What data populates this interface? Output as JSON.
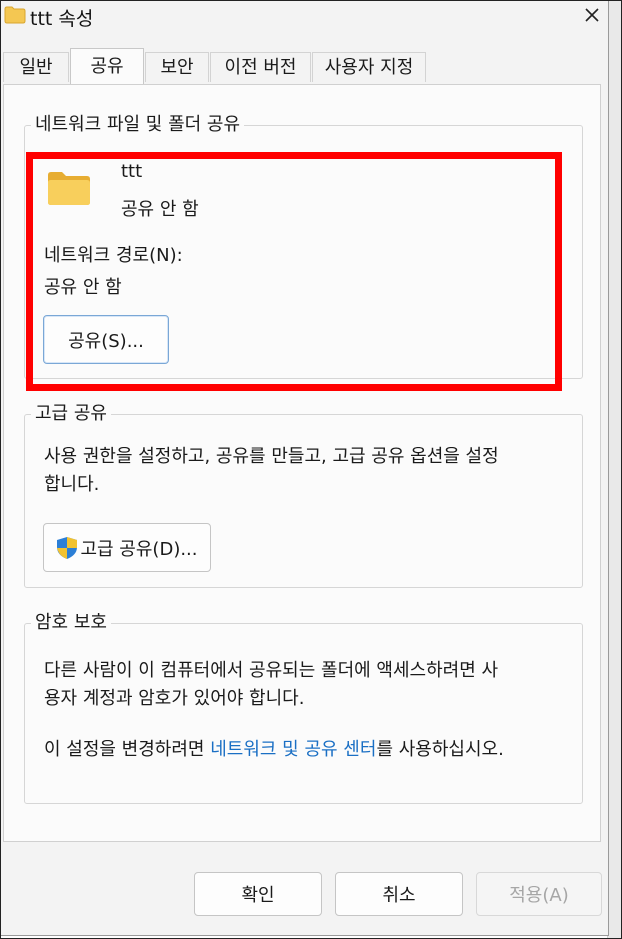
{
  "window": {
    "title": "ttt 속성"
  },
  "tabs": [
    {
      "label": "일반"
    },
    {
      "label": "공유"
    },
    {
      "label": "보안"
    },
    {
      "label": "이전 버전"
    },
    {
      "label": "사용자 지정"
    }
  ],
  "network_sharing": {
    "group_title": "네트워크 파일 및 폴더 공유",
    "folder_name": "ttt",
    "folder_status": "공유 안 함",
    "path_label": "네트워크 경로(N):",
    "path_value": "공유 안 함",
    "share_button": "공유(S)..."
  },
  "advanced_sharing": {
    "group_title": "고급 공유",
    "description_line1": "사용 권한을 설정하고, 공유를 만들고, 고급 공유 옵션을 설정",
    "description_line2": "합니다.",
    "button": "고급 공유(D)..."
  },
  "password_protection": {
    "group_title": "암호 보호",
    "line1": "다른 사람이 이 컴퓨터에서 공유되는 폴더에 액세스하려면 사",
    "line2": "용자 계정과 암호가 있어야 합니다.",
    "line3_prefix": "이 설정을 변경하려면 ",
    "line3_link": "네트워크 및 공유 센터",
    "line3_suffix": "를 사용하십시오."
  },
  "footer": {
    "ok": "확인",
    "cancel": "취소",
    "apply": "적용(A)"
  },
  "colors": {
    "highlight_box": "#ff0000",
    "link": "#1a6fc4",
    "folder": "#f4c752"
  }
}
